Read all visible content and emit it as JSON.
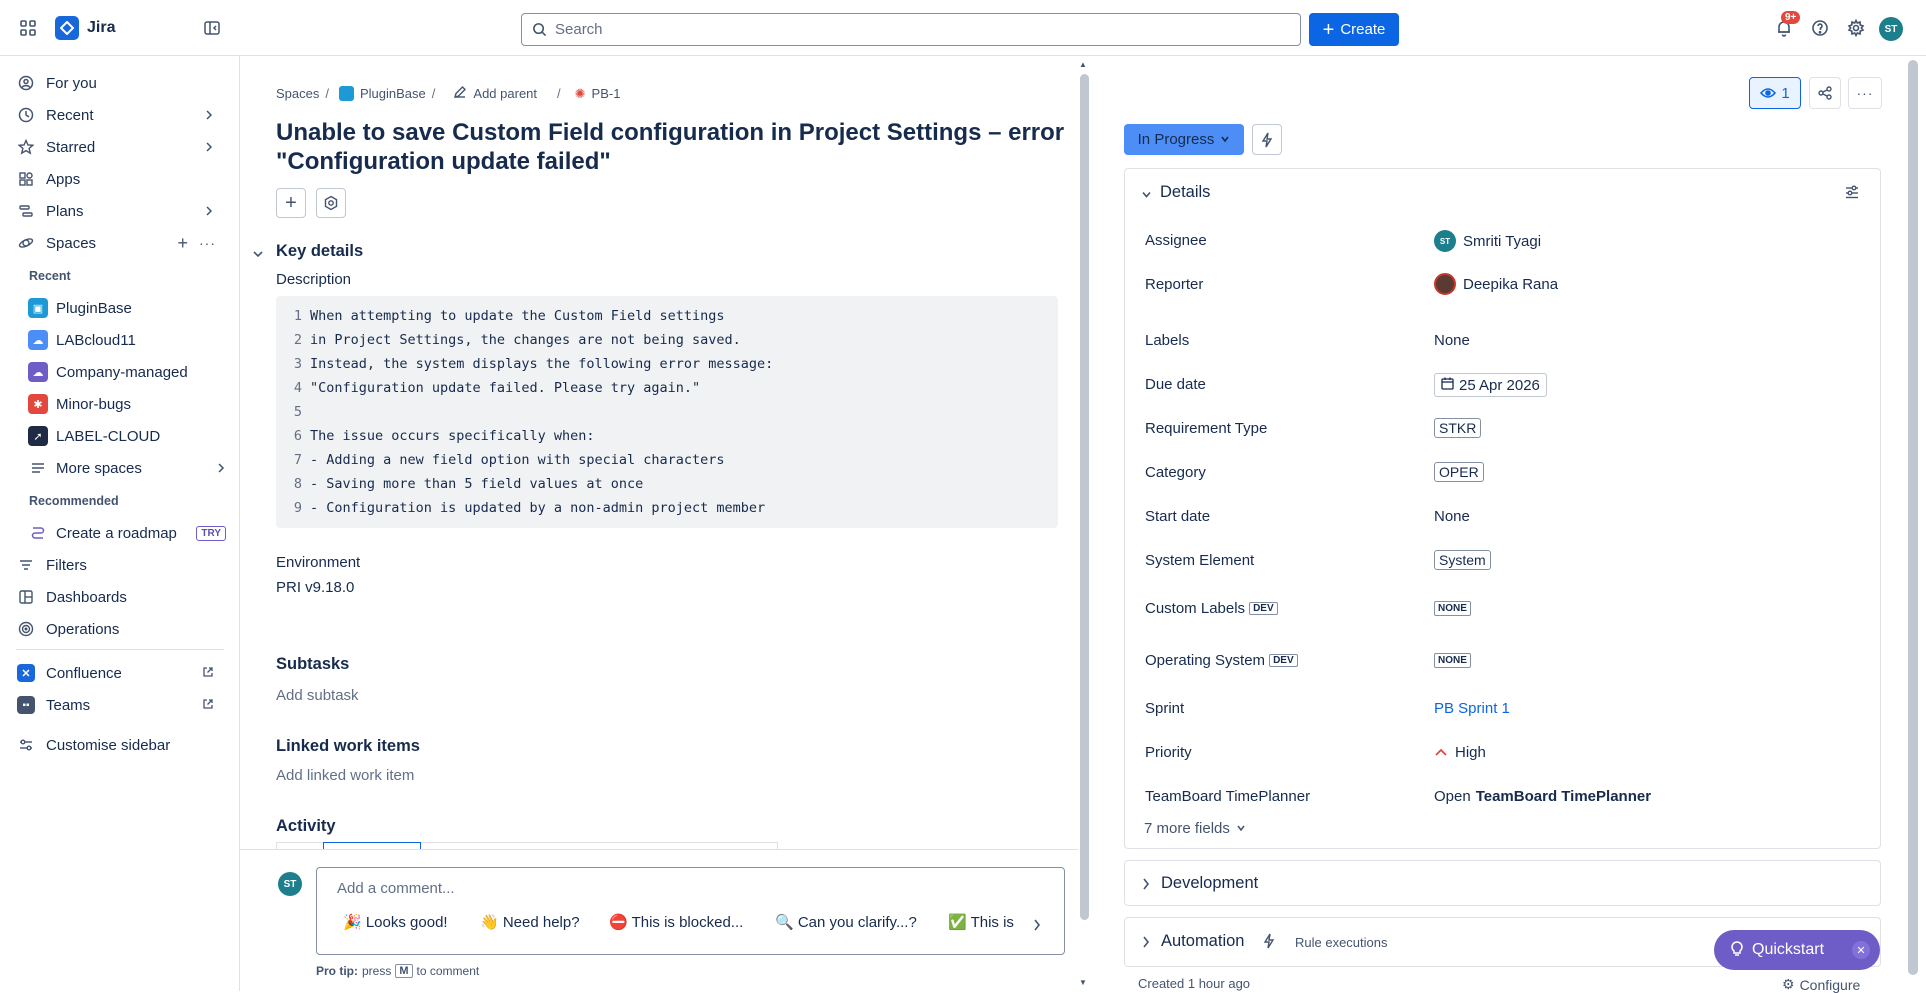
{
  "app": {
    "name": "Jira"
  },
  "topbar": {
    "search_placeholder": "Search",
    "create_label": "Create",
    "notification_badge": "9+",
    "avatar_initials": "ST"
  },
  "sidebar": {
    "items": [
      {
        "label": "For you",
        "icon": "person-circle-icon"
      },
      {
        "label": "Recent",
        "icon": "clock-icon"
      },
      {
        "label": "Starred",
        "icon": "star-icon"
      },
      {
        "label": "Apps",
        "icon": "apps-icon"
      },
      {
        "label": "Plans",
        "icon": "plans-icon"
      },
      {
        "label": "Spaces",
        "icon": "spaces-icon"
      }
    ],
    "recent_heading": "Recent",
    "spaces": [
      "PluginBase",
      "LABcloud11",
      "Company-managed",
      "Minor-bugs",
      "LABEL-CLOUD"
    ],
    "more_spaces": "More spaces",
    "recommended_heading": "Recommended",
    "create_roadmap": "Create a roadmap",
    "try_badge": "TRY",
    "filters": "Filters",
    "dashboards": "Dashboards",
    "operations": "Operations",
    "confluence": "Confluence",
    "teams": "Teams",
    "customise": "Customise sidebar"
  },
  "breadcrumb": {
    "spaces": "Spaces",
    "project": "PluginBase",
    "add_parent": "Add parent",
    "issue_key": "PB-1"
  },
  "issue": {
    "title": "Unable to save Custom Field configuration in Project Settings – error \"Configuration update failed\"",
    "key_details": "Key details",
    "description_label": "Description",
    "description_lines": [
      "When attempting to update the Custom Field settings",
      "in Project Settings, the changes are not being saved.",
      "Instead, the system displays the following error message:",
      "\"Configuration update failed. Please try again.\"",
      "",
      "The issue occurs specifically when:",
      "- Adding a new field option with special characters",
      "- Saving more than 5 field values at once",
      "- Configuration is updated by a non-admin project member"
    ],
    "environment_label": "Environment",
    "environment_value": "PRI v9.18.0",
    "subtasks_heading": "Subtasks",
    "add_subtask": "Add subtask",
    "linked_heading": "Linked work items",
    "add_linked": "Add linked work item",
    "activity_heading": "Activity"
  },
  "comment": {
    "placeholder": "Add a comment...",
    "chips": [
      "🎉 Looks good!",
      "👋 Need help?",
      "⛔ This is blocked...",
      "🔍 Can you clarify...?",
      "✅ This is c"
    ],
    "pro_tip_bold": "Pro tip:",
    "pro_tip_press": "press",
    "pro_tip_key": "M",
    "pro_tip_rest": "to comment"
  },
  "right": {
    "watch_count": "1",
    "status": "In Progress",
    "details_heading": "Details",
    "fields": {
      "assignee": {
        "label": "Assignee",
        "value": "Smriti Tyagi",
        "initials": "ST"
      },
      "reporter": {
        "label": "Reporter",
        "value": "Deepika Rana"
      },
      "labels": {
        "label": "Labels",
        "value": "None"
      },
      "due_date": {
        "label": "Due date",
        "value": "25 Apr 2026"
      },
      "requirement_type": {
        "label": "Requirement Type",
        "value": "STKR"
      },
      "category": {
        "label": "Category",
        "value": "OPER"
      },
      "start_date": {
        "label": "Start date",
        "value": "None"
      },
      "system_element": {
        "label": "System Element",
        "value": "System"
      },
      "custom_labels": {
        "label": "Custom Labels",
        "badge": "DEV",
        "value": "NONE"
      },
      "operating_system": {
        "label": "Operating System",
        "badge": "DEV",
        "value": "NONE"
      },
      "sprint": {
        "label": "Sprint",
        "value": "PB Sprint 1"
      },
      "priority": {
        "label": "Priority",
        "value": "High"
      },
      "teamboard": {
        "label": "TeamBoard TimePlanner",
        "value_prefix": "Open",
        "value_bold": "TeamBoard TimePlanner"
      }
    },
    "more_fields": "7 more fields",
    "development": "Development",
    "automation": "Automation",
    "rule_executions": "Rule executions",
    "created": "Created 1 hour ago",
    "configure": "Configure"
  },
  "quickstart": {
    "label": "Quickstart"
  },
  "colors": {
    "accent": "#0c66e4",
    "status": "#4c8df6",
    "quickstart": "#6e5dc6",
    "priority_high": "#e2483d",
    "link": "#0c66e4"
  }
}
